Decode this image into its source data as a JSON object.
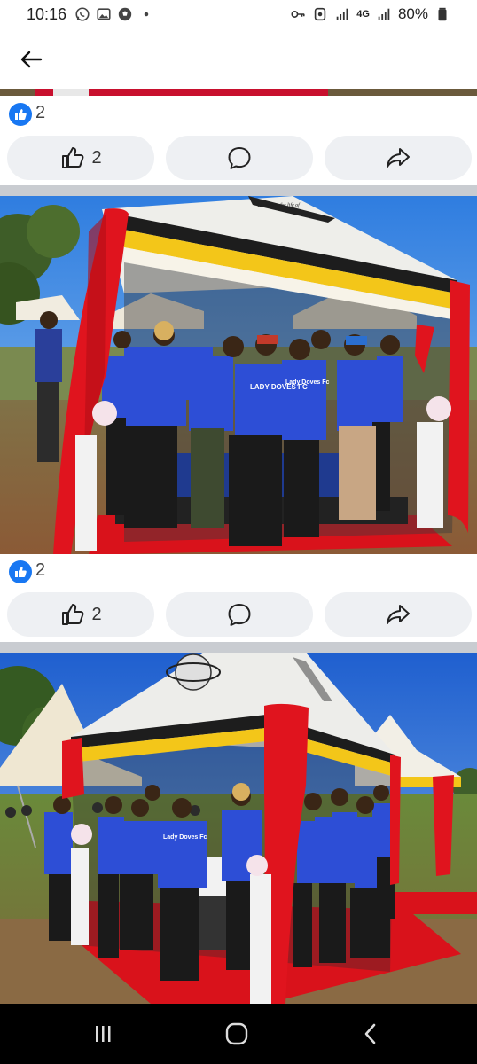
{
  "status_bar": {
    "time": "10:16",
    "left_icons": [
      "whatsapp-icon",
      "gallery-icon",
      "football-icon",
      "dot-icon"
    ],
    "network": "4G",
    "battery": "80%"
  },
  "header": {
    "back_icon": "back-arrow-icon"
  },
  "posts": [
    {
      "reactions": {
        "count": "2"
      },
      "actions": {
        "like_count": "2",
        "comment_icon": "comment-icon",
        "share_icon": "share-icon"
      }
    },
    {
      "photo_text": {
        "shirt_print": "LADY DOVES FC",
        "shirt_print_back": "Lady Doves Fc",
        "banner": "Celebrate the life of"
      },
      "reactions": {
        "count": "2"
      },
      "actions": {
        "like_count": "2",
        "comment_icon": "comment-icon",
        "share_icon": "share-icon"
      }
    },
    {
      "photo_text": {
        "shirt_print": "Lady Doves Fc"
      }
    }
  ],
  "nav_bar": {
    "recents": "recents-icon",
    "home": "home-icon",
    "back": "back-icon"
  },
  "colors": {
    "accent": "#1877f2",
    "tent_red": "#e0141e",
    "tent_yellow": "#f3c619",
    "shirt_blue": "#2d4ed6"
  }
}
